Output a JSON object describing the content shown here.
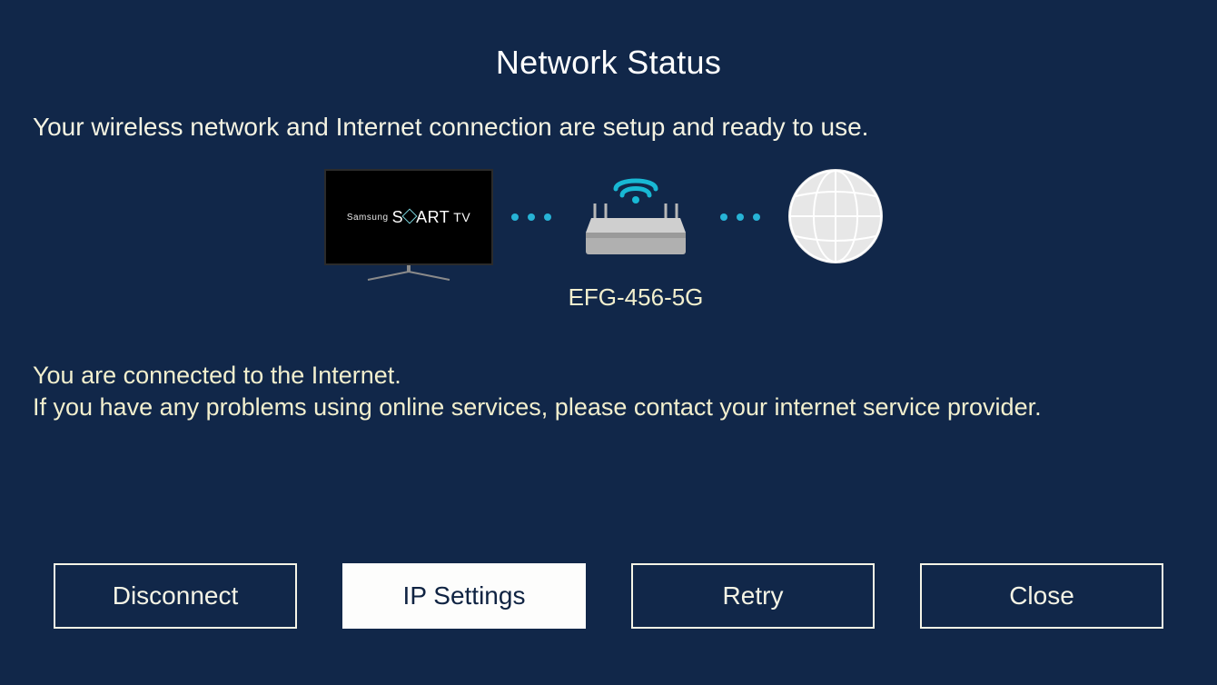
{
  "title": "Network Status",
  "subtitle": "Your wireless network and Internet connection are setup and ready to use.",
  "tv_brand_prefix": "Samsung",
  "tv_brand_main_left": "S",
  "tv_brand_main_right": "ART",
  "tv_brand_suffix": "TV",
  "ssid": "EFG-456-5G",
  "status_line1": "You are connected to the Internet.",
  "status_line2": "If you have any problems using online services, please contact your internet service provider.",
  "buttons": {
    "disconnect": "Disconnect",
    "ip_settings": "IP Settings",
    "retry": "Retry",
    "close": "Close"
  }
}
